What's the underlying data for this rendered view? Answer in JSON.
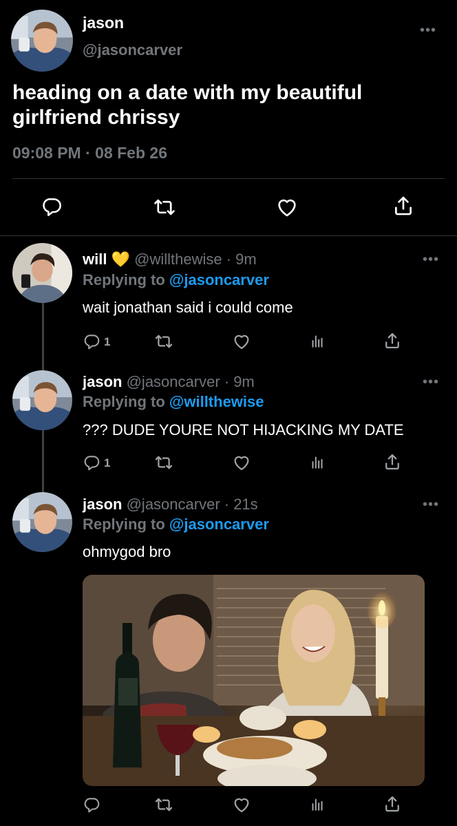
{
  "main_tweet": {
    "name": "jason",
    "handle": "@jasoncarver",
    "text": "heading on a date with my beautiful girlfriend chrissy",
    "timestamp": "09:08 PM · 08 Feb 26",
    "more_label": "•••",
    "actions": [
      "reply-icon",
      "retweet-icon",
      "like-icon",
      "share-icon"
    ]
  },
  "replies": [
    {
      "name": "will",
      "emoji": "💛",
      "handle_time": "@willthewise · 9m",
      "replying_prefix": "Replying to",
      "replying_to": "@jasoncarver",
      "text": "wait jonathan said i could come",
      "reply_count": "1",
      "more_label": "•••"
    },
    {
      "name": "jason",
      "handle_time": "@jasoncarver · 9m",
      "replying_prefix": "Replying to",
      "replying_to": "@willthewise",
      "text": "??? DUDE YOURE NOT HIJACKING MY DATE",
      "reply_count": "1",
      "more_label": "•••"
    },
    {
      "name": "jason",
      "handle_time": "@jasoncarver · 21s",
      "replying_prefix": "Replying to",
      "replying_to": "@jasoncarver",
      "text": "ohmygod bro",
      "reply_count": "",
      "more_label": "•••",
      "media": "photo of two people at a candlelit dinner table"
    }
  ],
  "colors": {
    "background": "#000000",
    "text": "#ffffff",
    "secondary": "#71767b",
    "accent": "#1d9bf0",
    "divider": "#2f3336"
  }
}
